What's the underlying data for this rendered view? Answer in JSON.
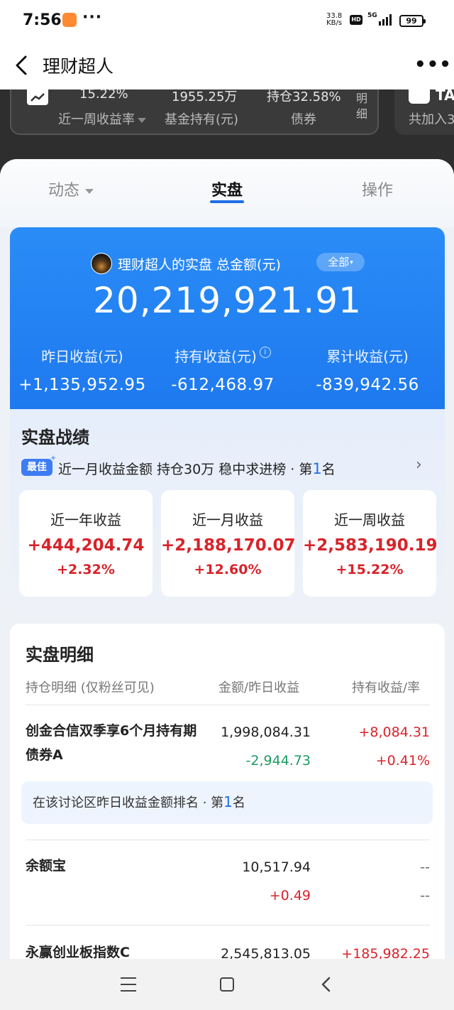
{
  "status_bar": {
    "time": "7:56",
    "net_speed_value": "33.8",
    "net_speed_unit": "KB/s",
    "hd": "HD",
    "network": "5G",
    "battery": "99"
  },
  "nav": {
    "title": "理财超人"
  },
  "top_card": {
    "weekly_rate_value": "15.22%",
    "weekly_rate_label": "近一周收益率",
    "fund_holding_value": "1955.25万",
    "fund_holding_label": "基金持有(元)",
    "bond_value": "持仓32.58%",
    "bond_label": "债券",
    "detail_label": "明细",
    "side_title": "TA",
    "side_label": "共加入3"
  },
  "tabs": [
    {
      "label": "动态"
    },
    {
      "label": "实盘"
    },
    {
      "label": "操作"
    }
  ],
  "account": {
    "title": "理财超人的实盘 总金额(元)",
    "filter": "全部",
    "total": "20,219,921.91",
    "stats": [
      {
        "label": "昨日收益(元)",
        "value": "+1,135,952.95"
      },
      {
        "label": "持有收益(元)",
        "value": "-612,468.97"
      },
      {
        "label": "累计收益(元)",
        "value": "-839,942.56"
      }
    ]
  },
  "performance": {
    "title": "实盘战绩",
    "badge": "最佳",
    "rank_text": "近一月收益金额 持仓30万 稳中求进榜 · 第",
    "rank_num": "1",
    "rank_suffix": "名",
    "cards": [
      {
        "label": "近一年收益",
        "value": "+444,204.74",
        "pct": "+2.32%"
      },
      {
        "label": "近一月收益",
        "value": "+2,188,170.07",
        "pct": "+12.60%"
      },
      {
        "label": "近一周收益",
        "value": "+2,583,190.19",
        "pct": "+15.22%"
      }
    ]
  },
  "details": {
    "title": "实盘明细",
    "headers": {
      "name": "持仓明细 (仅粉丝可见)",
      "amount": "金额/昨日收益",
      "profit": "持有收益/率"
    },
    "rows": [
      {
        "name": "创金合信双季享6个月持有期债券A",
        "amount": "1,998,084.31",
        "yesterday": "-2,944.73",
        "profit": "+8,084.31",
        "rate": "+0.41%"
      },
      {
        "name": "余额宝",
        "amount": "10,517.94",
        "yesterday": "+0.49",
        "profit": "--",
        "rate": "--"
      },
      {
        "name": "永赢创业板指数C",
        "amount": "2,545,813.05",
        "profit": "+185,982.25"
      }
    ],
    "rank_text": "在该讨论区昨日收益金额排名 · 第",
    "rank_num": "1",
    "rank_suffix": "名"
  },
  "colors": {
    "accent_blue": "#1f6fe5",
    "gain_red": "#d8232a",
    "loss_green": "#1d9a64"
  }
}
